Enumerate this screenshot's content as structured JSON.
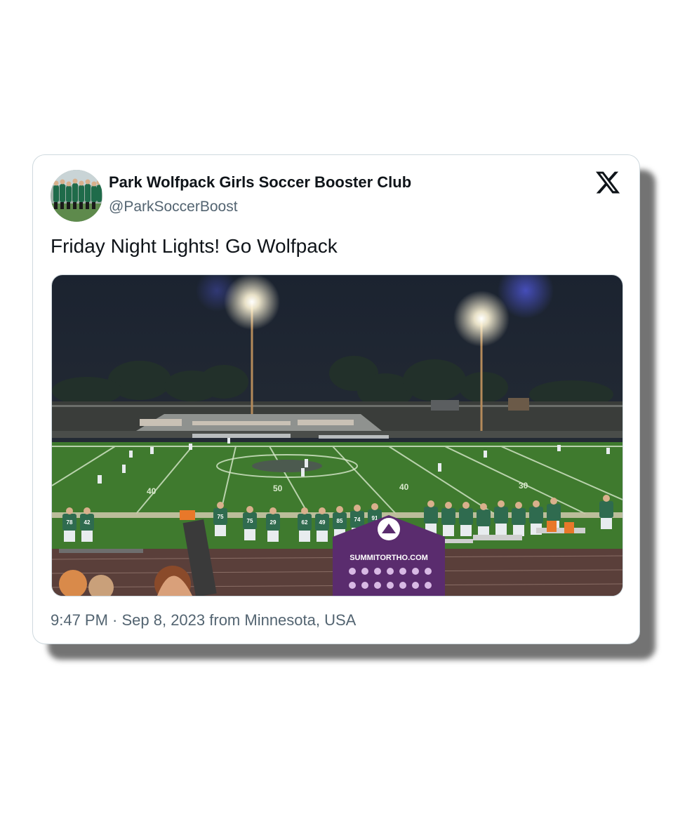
{
  "tweet": {
    "display_name": "Park Wolfpack Girls Soccer Booster Club",
    "handle": "@ParkSoccerBoost",
    "text": "Friday Night Lights! Go Wolfpack",
    "timestamp": "9:47 PM · Sep 8, 2023 from Minnesota, USA"
  },
  "media": {
    "tent_text": "SUMMITORTHO.COM",
    "yard_markers": [
      "40",
      "50",
      "40",
      "30"
    ],
    "jersey_numbers": [
      "78",
      "42",
      "75",
      "29",
      "62",
      "49",
      "85",
      "74",
      "91"
    ]
  },
  "icons": {
    "brand": "x-logo-icon"
  },
  "colors": {
    "name_text": "#0f1419",
    "secondary_text": "#536471",
    "border": "#cfd9de",
    "field_green": "#3f7a2e",
    "jersey_green": "#2f6b4f",
    "tent_purple": "#5a2c6e"
  }
}
